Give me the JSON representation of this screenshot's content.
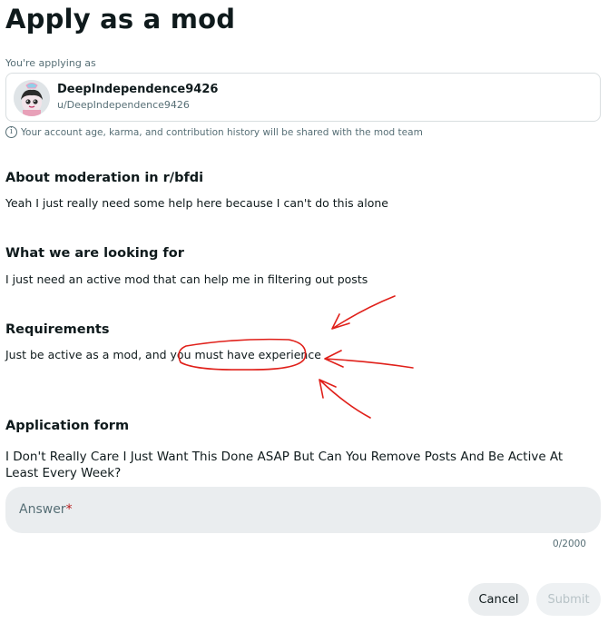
{
  "page": {
    "title": "Apply as a mod"
  },
  "applicant": {
    "label": "You're applying as",
    "username": "DeepIndependence9426",
    "handle": "u/DeepIndependence9426",
    "notice": "Your account age, karma, and contribution history will be shared with the mod team"
  },
  "sections": [
    {
      "heading": "About moderation in r/bfdi",
      "text": "Yeah I just really need some help here because I can't do this alone"
    },
    {
      "heading": "What we are looking for",
      "text": "I just need an active mod that can help me in filtering out posts"
    },
    {
      "heading": "Requirements",
      "text_before": "Just be active as a mod, and you ",
      "text_highlight": "must have experience"
    }
  ],
  "form": {
    "heading": "Application form",
    "question": "I Don't Really Care I Just Want This Done ASAP But Can You Remove Posts And Be Active At Least Every Week?",
    "answer_placeholder": "Answer",
    "required_mark": "*",
    "answer_value": "",
    "counter": "0/2000"
  },
  "buttons": {
    "cancel": "Cancel",
    "submit": "Submit"
  },
  "colors": {
    "annotation": "#e0201a",
    "text_secondary": "#576f76",
    "input_bg": "#eaedef"
  }
}
